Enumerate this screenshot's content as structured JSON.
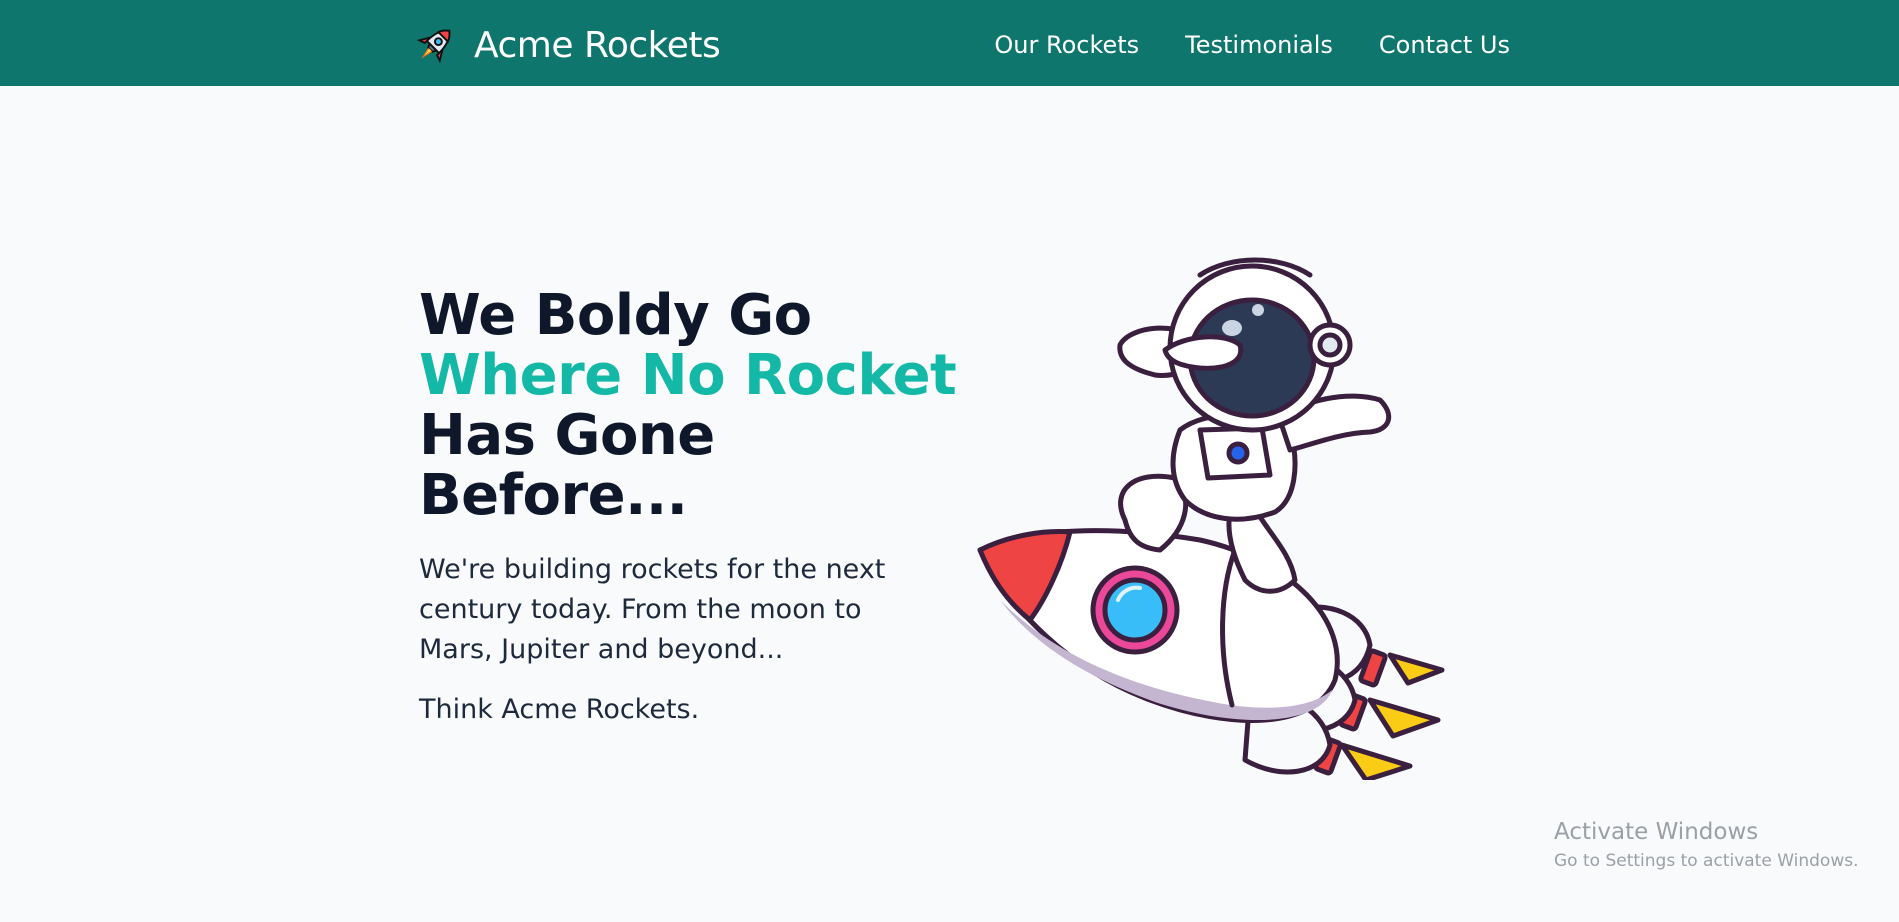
{
  "header": {
    "brand_name": "Acme Rockets",
    "brand_icon": "rocket-icon",
    "nav": [
      {
        "label": "Our Rockets"
      },
      {
        "label": "Testimonials"
      },
      {
        "label": "Contact Us"
      }
    ]
  },
  "hero": {
    "headline_line1": "We Boldy Go",
    "headline_accent": "Where No Rocket",
    "headline_line3": "Has Gone",
    "headline_line4": "Before...",
    "description": "We're building rockets for the next century today. From the moon to Mars, Jupiter and beyond...",
    "tagline": "Think Acme Rockets.",
    "illustration": "astronaut-riding-rocket"
  },
  "system_overlay": {
    "title": "Activate Windows",
    "subtitle": "Go to Settings to activate Windows."
  },
  "colors": {
    "header_bg": "#0f766e",
    "page_bg": "#f8fafc",
    "accent": "#14b8a6",
    "heading": "#0f172a"
  }
}
